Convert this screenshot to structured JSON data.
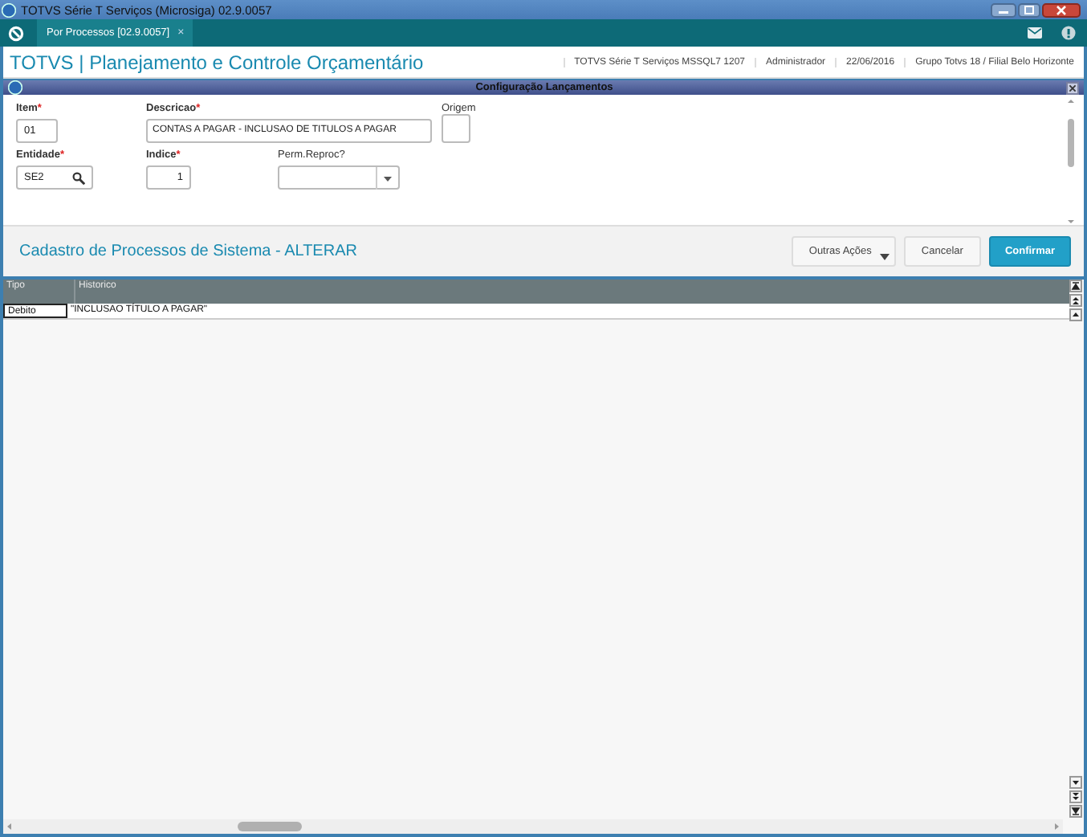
{
  "window": {
    "title": "TOTVS Série T Serviços (Microsiga) 02.9.0057"
  },
  "tabs": [
    {
      "label": "Por Processos [02.9.0057]",
      "selected": true,
      "close": "×"
    }
  ],
  "header": {
    "app_title": "TOTVS | Planejamento e Controle Orçamentário",
    "info": [
      "TOTVS Série T Serviços MSSQL7 1207",
      "Administrador",
      "22/06/2016",
      "Grupo Totvs 18 / Filial Belo Horizonte"
    ]
  },
  "dialog": {
    "title": "Configuração Lançamentos",
    "fields": [
      {
        "label": "Item",
        "mark": "*",
        "kind": "text",
        "value": "01"
      },
      {
        "label": "Descricao",
        "mark": "*",
        "kind": "wide",
        "value": "CONTAS A PAGAR - INCLUSAO DE TITULOS A PAGAR"
      },
      {
        "label": "Origem",
        "kind": "square"
      },
      {
        "label": "Entidade",
        "mark": "*",
        "kind": "lookup",
        "value": "SE2"
      },
      {
        "label": "Indice",
        "mark": "*",
        "kind": "number",
        "value": "1"
      },
      {
        "label": "Perm.Reproc?",
        "kind": "select"
      }
    ]
  },
  "form_title": "Cadastro de Processos de Sistema - ALTERAR",
  "buttons": [
    {
      "label": "Outras Ações",
      "kind": "menu"
    },
    {
      "label": "Cancelar",
      "kind": "plain"
    },
    {
      "label": "Confirmar",
      "kind": "primary"
    }
  ],
  "table": {
    "columns": [
      "Tipo",
      "Historico"
    ],
    "rows": [
      [
        "Debito",
        "\"INCLUSAO TÍTULO A PAGAR\""
      ]
    ]
  }
}
